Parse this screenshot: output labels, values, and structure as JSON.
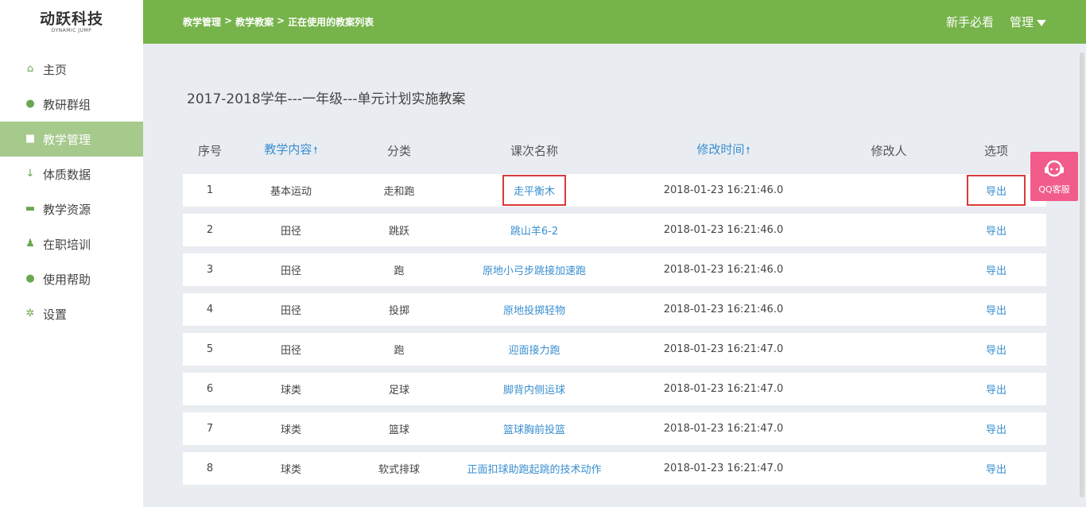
{
  "logo": {
    "main": "动跃科技",
    "sub": "DYNAMIC JUMP"
  },
  "sidebar": {
    "items": [
      {
        "label": "主页",
        "icon": "home-icon"
      },
      {
        "label": "教研群组",
        "icon": "group-icon"
      },
      {
        "label": "教学管理",
        "icon": "edit-icon",
        "active": true
      },
      {
        "label": "体质数据",
        "icon": "fitness-icon"
      },
      {
        "label": "教学资源",
        "icon": "resource-icon"
      },
      {
        "label": "在职培训",
        "icon": "training-icon"
      },
      {
        "label": "使用帮助",
        "icon": "help-icon"
      },
      {
        "label": "设置",
        "icon": "gear-icon"
      }
    ]
  },
  "header": {
    "breadcrumb": [
      "教学管理",
      ">",
      "教学教案",
      ">",
      "正在使用的教案列表"
    ],
    "guide": "新手必看",
    "manage": "管理"
  },
  "page": {
    "title": "2017-2018学年---一年级---单元计划实施教案"
  },
  "table": {
    "columns": [
      "序号",
      "教学内容",
      "分类",
      "课次名称",
      "修改时间",
      "修改人",
      "选项"
    ],
    "rows": [
      {
        "no": "1",
        "content": "基本运动",
        "category": "走和跑",
        "lesson": "走平衡木",
        "time": "2018-01-23 16:21:46.0",
        "editor": "",
        "action": "导出"
      },
      {
        "no": "2",
        "content": "田径",
        "category": "跳跃",
        "lesson": "跳山羊6-2",
        "time": "2018-01-23 16:21:46.0",
        "editor": "",
        "action": "导出"
      },
      {
        "no": "3",
        "content": "田径",
        "category": "跑",
        "lesson": "原地小弓步跳接加速跑",
        "time": "2018-01-23 16:21:46.0",
        "editor": "",
        "action": "导出"
      },
      {
        "no": "4",
        "content": "田径",
        "category": "投掷",
        "lesson": "原地投掷轻物",
        "time": "2018-01-23 16:21:46.0",
        "editor": "",
        "action": "导出"
      },
      {
        "no": "5",
        "content": "田径",
        "category": "跑",
        "lesson": "迎面接力跑",
        "time": "2018-01-23 16:21:47.0",
        "editor": "",
        "action": "导出"
      },
      {
        "no": "6",
        "content": "球类",
        "category": "足球",
        "lesson": "脚背内侧运球",
        "time": "2018-01-23 16:21:47.0",
        "editor": "",
        "action": "导出"
      },
      {
        "no": "7",
        "content": "球类",
        "category": "篮球",
        "lesson": "篮球胸前投篮",
        "time": "2018-01-23 16:21:47.0",
        "editor": "",
        "action": "导出"
      },
      {
        "no": "8",
        "content": "球类",
        "category": "软式排球",
        "lesson": "正面扣球助跑起跳的技术动作",
        "time": "2018-01-23 16:21:47.0",
        "editor": "",
        "action": "导出"
      }
    ]
  },
  "qq": {
    "label": "QQ客服"
  },
  "colors": {
    "primary": "#76b34a",
    "link": "#3a8fd0",
    "highlight": "#d93a3a",
    "qq": "#f25c8a"
  }
}
